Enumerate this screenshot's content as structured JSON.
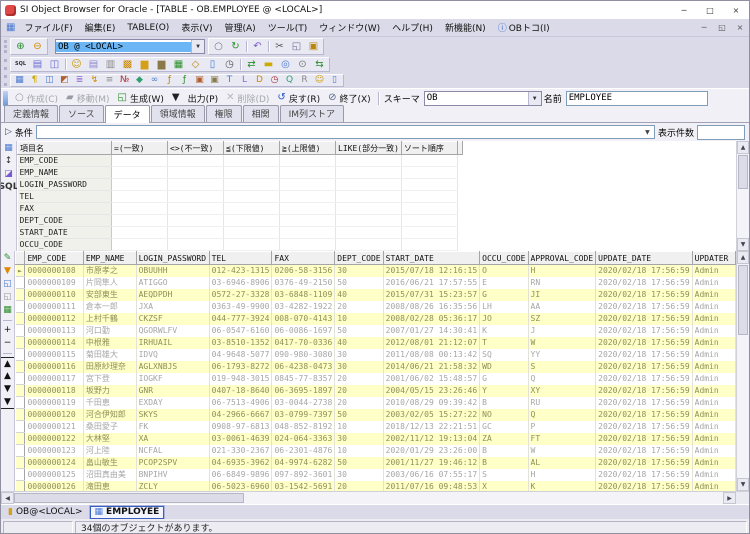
{
  "window": {
    "title": "SI Object Browser for Oracle - [TABLE - OB.EMPLOYEE @ <LOCAL>]",
    "controls": [
      {
        "name": "minimize-button",
        "glyph": "─"
      },
      {
        "name": "maximize-button",
        "glyph": "□"
      },
      {
        "name": "close-button",
        "glyph": "×"
      }
    ]
  },
  "menubar": {
    "items": [
      {
        "label": "ファイル(F)"
      },
      {
        "label": "編集(E)"
      },
      {
        "label": "TABLE(O)"
      },
      {
        "label": "表示(V)"
      },
      {
        "label": "管理(A)"
      },
      {
        "label": "ツール(T)"
      },
      {
        "label": "ウィンドウ(W)"
      },
      {
        "label": "ヘルプ(H)"
      },
      {
        "label": "新機能(N)"
      },
      {
        "label": "OBトコ(I)",
        "icon_name": "info-icon",
        "icon_glyph": "ⓘ",
        "icon_color": "#3366cc"
      }
    ],
    "controls": [
      {
        "name": "mdi-minimize-button",
        "glyph": "─"
      },
      {
        "name": "mdi-restore-button",
        "glyph": "◱"
      },
      {
        "name": "mdi-close-button",
        "glyph": "×"
      }
    ]
  },
  "toolbar1": {
    "icons_left": [
      {
        "name": "connect-icon",
        "glyph": "⊕",
        "color": "#2a8f2a"
      },
      {
        "name": "disconnect-icon",
        "glyph": "⊖",
        "color": "#cc8800"
      }
    ],
    "connection_value": "OB @ <LOCAL>",
    "icons_right": [
      {
        "name": "cancel-query-icon",
        "glyph": "○",
        "color": "#777777"
      },
      {
        "name": "refresh-icon",
        "glyph": "↻",
        "color": "#2a8f2a"
      },
      {
        "sep": true
      },
      {
        "name": "undo-icon",
        "glyph": "↶",
        "color": "#7a5ad0"
      },
      {
        "sep": true
      },
      {
        "name": "cut-icon",
        "glyph": "✂",
        "color": "#555555"
      },
      {
        "name": "copy-icon",
        "glyph": "◱",
        "color": "#777799"
      },
      {
        "name": "paste-icon",
        "glyph": "▣",
        "color": "#b8860b"
      }
    ]
  },
  "toolbar2": {
    "icons": [
      {
        "name": "sql-editor-icon",
        "glyph": "SQL",
        "color": "#333333",
        "small": true
      },
      {
        "name": "script-editor-icon",
        "glyph": "▤",
        "color": "#6a6ad0"
      },
      {
        "name": "session-list-icon",
        "glyph": "◫",
        "color": "#6a6ad0"
      },
      {
        "sep": true
      },
      {
        "name": "user-icon",
        "glyph": "☺",
        "color": "#cc9900"
      },
      {
        "name": "tablespace-icon",
        "glyph": "▤",
        "color": "#8888cc"
      },
      {
        "name": "printer-icon",
        "glyph": "▥",
        "color": "#888888"
      },
      {
        "name": "lock-icon",
        "glyph": "▩",
        "color": "#cc8800"
      },
      {
        "name": "folder-icon",
        "glyph": "▆",
        "color": "#d4a017"
      },
      {
        "name": "folder-dark-icon",
        "glyph": "▆",
        "color": "#8a7a4a"
      },
      {
        "name": "data-grid-icon",
        "glyph": "▦",
        "color": "#2a8f2a"
      },
      {
        "name": "package-icon",
        "glyph": "◇",
        "color": "#b8860b"
      },
      {
        "name": "document-icon",
        "glyph": "▯",
        "color": "#4a7ad0"
      },
      {
        "name": "history-icon",
        "glyph": "◷",
        "color": "#555555"
      },
      {
        "sep": true
      },
      {
        "name": "refresh-objects-icon",
        "glyph": "⇄",
        "color": "#2a8f2a"
      },
      {
        "name": "memo-icon",
        "glyph": "▬",
        "color": "#ccaa00"
      },
      {
        "name": "find-object-icon",
        "glyph": "◎",
        "color": "#4a7ad0"
      },
      {
        "name": "zoom-icon",
        "glyph": "⊙",
        "color": "#777777"
      },
      {
        "name": "sync-table-icon",
        "glyph": "⇆",
        "color": "#2a8f2a"
      }
    ]
  },
  "toolbar3": {
    "icons": [
      {
        "name": "table-object-icon",
        "glyph": "▦",
        "color": "#4a7ad0"
      },
      {
        "name": "key-object-icon",
        "glyph": "¶",
        "color": "#ccaa00"
      },
      {
        "name": "view-object-icon",
        "glyph": "◫",
        "color": "#4a7ad0"
      },
      {
        "name": "mview-object-icon",
        "glyph": "◩",
        "color": "#b06030"
      },
      {
        "name": "index-object-icon",
        "glyph": "≣",
        "color": "#8a6ad0"
      },
      {
        "name": "trigger-object-icon",
        "glyph": "↯",
        "color": "#cc8800"
      },
      {
        "name": "synonym-object-icon",
        "glyph": "≡",
        "color": "#888888"
      },
      {
        "name": "sequence-object-icon",
        "glyph": "№",
        "color": "#b03030"
      },
      {
        "name": "cluster-object-icon",
        "glyph": "◆",
        "color": "#30a070"
      },
      {
        "name": "dblink-object-icon",
        "glyph": "∞",
        "color": "#4a7ad0"
      },
      {
        "name": "procedure-object-icon",
        "glyph": "ƒ",
        "color": "#b8860b"
      },
      {
        "name": "function-object-icon",
        "glyph": "ƒ",
        "color": "#2a8f2a"
      },
      {
        "name": "package-object-icon",
        "glyph": "▣",
        "color": "#b06030"
      },
      {
        "name": "package-body-object-icon",
        "glyph": "▣",
        "color": "#8a7a4a"
      },
      {
        "name": "type-object-icon",
        "glyph": "T",
        "color": "#4a7ad0"
      },
      {
        "name": "library-object-icon",
        "glyph": "L",
        "color": "#8a6ad0"
      },
      {
        "name": "directory-object-icon",
        "glyph": "D",
        "color": "#cc8800"
      },
      {
        "name": "job-object-icon",
        "glyph": "◷",
        "color": "#b03030"
      },
      {
        "name": "queue-object-icon",
        "glyph": "Q",
        "color": "#30a070"
      },
      {
        "name": "role-object-icon",
        "glyph": "R",
        "color": "#888888"
      },
      {
        "name": "user-object-icon",
        "glyph": "☺",
        "color": "#cc9900"
      },
      {
        "name": "recyclebin-object-icon",
        "glyph": "▯",
        "color": "#4a7ad0"
      }
    ]
  },
  "action_bar": {
    "buttons": [
      {
        "name": "create-button",
        "glyph": "○",
        "color": "#9a9aa6",
        "label": "作成(C)",
        "disabled": true
      },
      {
        "name": "move-button",
        "glyph": "▰",
        "color": "#9a9aa6",
        "label": "移動(M)",
        "disabled": true
      },
      {
        "name": "generate-button",
        "glyph": "◱",
        "color": "#2a8f2a",
        "label": "生成(W)",
        "disabled": false
      },
      {
        "name": "generate-dropdown",
        "glyph": "▼",
        "color": "#222222",
        "label": "",
        "disabled": false
      },
      {
        "name": "output-button",
        "glyph": "",
        "color": "",
        "label": "出力(P)",
        "disabled": false
      },
      {
        "name": "delete-button",
        "glyph": "✕",
        "color": "#b6b6be",
        "label": "削除(D)",
        "disabled": true
      },
      {
        "name": "revert-button",
        "glyph": "↺",
        "color": "#2255cc",
        "label": "戻す(R)",
        "disabled": false
      },
      {
        "name": "close-table-button",
        "glyph": "⊘",
        "color": "#556688",
        "label": "終了(X)",
        "disabled": false
      }
    ],
    "schema_label": "スキーマ",
    "schema_value": "OB",
    "name_label": "名前",
    "name_value": "EMPLOYEE"
  },
  "tabs": {
    "items": [
      "定義情報",
      "ソース",
      "データ",
      "領域情報",
      "権限",
      "相関",
      "IM列ストア"
    ],
    "active": "データ"
  },
  "condition": {
    "label": "条件",
    "value": "",
    "count_label": "表示件数",
    "count_value": ""
  },
  "filter_grid": {
    "toolbar": [
      {
        "name": "filter-grid-icon",
        "glyph": "▦",
        "color": "#4a7ad0"
      },
      {
        "name": "toggle-condition-icon",
        "glyph": "↕",
        "color": "#333333"
      },
      {
        "name": "clear-condition-icon",
        "glyph": "◪",
        "color": "#7a5ad0"
      },
      {
        "name": "show-sql-icon",
        "glyph": "SQL",
        "color": "#333333",
        "small": true
      }
    ],
    "headers": [
      "項目名",
      "=(一致)",
      "<>(不一致)",
      "≦(下限値)",
      "≧(上限値)",
      "LIKE(部分一致)",
      "ソート順序"
    ],
    "fields": [
      "EMP_CODE",
      "EMP_NAME",
      "LOGIN_PASSWORD",
      "TEL",
      "FAX",
      "DEPT_CODE",
      "START_DATE",
      "OCCU_CODE"
    ]
  },
  "data_grid": {
    "toolbar": [
      {
        "name": "edit-mode-icon",
        "glyph": "✎",
        "color": "#2a8f2a"
      },
      {
        "name": "filter-rows-icon",
        "glyph": "▼",
        "color": "#e08800"
      },
      {
        "name": "copy-rows-icon",
        "glyph": "◱",
        "color": "#4a7ad0"
      },
      {
        "name": "paste-rows-icon",
        "glyph": "◱",
        "color": "#999999"
      },
      {
        "name": "export-grid-icon",
        "glyph": "▦",
        "color": "#2a8f2a"
      },
      {
        "sep": true
      },
      {
        "name": "insert-row-icon",
        "glyph": "+",
        "color": "#111111"
      },
      {
        "name": "delete-row-icon",
        "glyph": "−",
        "color": "#111111"
      },
      {
        "sep": true
      },
      {
        "name": "first-row-icon",
        "glyph": "▲",
        "color": "#111111",
        "cls": "bar-top"
      },
      {
        "name": "prev-row-icon",
        "glyph": "▲",
        "color": "#111111"
      },
      {
        "name": "next-row-icon",
        "glyph": "▼",
        "color": "#111111"
      },
      {
        "name": "last-row-icon",
        "glyph": "▼",
        "color": "#111111",
        "cls": "bar-bottom"
      }
    ],
    "columns": [
      "EMP_CODE",
      "EMP_NAME",
      "LOGIN_PASSWORD",
      "TEL",
      "FAX",
      "DEPT_CODE",
      "START_DATE",
      "OCCU_CODE",
      "APPROVAL_CODE",
      "UPDATE_DATE",
      "UPDATER"
    ],
    "rows": [
      [
        "0000000108",
        "市原孝之",
        "OBUUHH",
        "012-423-1315",
        "0206-58-3156",
        "30",
        "2015/07/18 12:16:15",
        "O",
        "H",
        "2020/02/18 17:56:59",
        "Admin"
      ],
      [
        "0000000109",
        "片岡隼人",
        "ATIGGO",
        "03-6946-8906",
        "0376-49-2150",
        "50",
        "2016/06/21 17:57:55",
        "E",
        "RN",
        "2020/02/18 17:56:59",
        "Admin"
      ],
      [
        "0000000110",
        "安部東生",
        "AEQDPDH",
        "0572-27-3328",
        "03-6848-1109",
        "40",
        "2015/07/31 15:23:57",
        "G",
        "JI",
        "2020/02/18 17:56:59",
        "Admin"
      ],
      [
        "0000000111",
        "倉本一郎",
        "JXA",
        "0363-49-9900",
        "03-4282-1922",
        "20",
        "2008/08/26 16:35:56",
        "LH",
        "AA",
        "2020/02/18 17:56:59",
        "Admin"
      ],
      [
        "0000000112",
        "上村千鶴",
        "CKZSF",
        "044-777-3924",
        "008-070-4143",
        "10",
        "2008/02/28 05:36:17",
        "JO",
        "SZ",
        "2020/02/18 17:56:59",
        "Admin"
      ],
      [
        "0000000113",
        "河口勤",
        "QGORWLFV",
        "06-0547-6160",
        "06-0086-1697",
        "50",
        "2007/01/27 14:30:41",
        "K",
        "J",
        "2020/02/18 17:56:59",
        "Admin"
      ],
      [
        "0000000114",
        "中根雅",
        "IRHUAIL",
        "03-8510-1352",
        "0417-70-0336",
        "40",
        "2012/08/01 21:12:07",
        "T",
        "W",
        "2020/02/18 17:56:59",
        "Admin"
      ],
      [
        "0000000115",
        "菊田雄大",
        "IDVQ",
        "04-9648-5077",
        "090-980-3080",
        "30",
        "2011/08/08 00:13:42",
        "SQ",
        "YY",
        "2020/02/18 17:56:59",
        "Admin"
      ],
      [
        "0000000116",
        "田原紗理奈",
        "AGLXNBJS",
        "06-1793-8272",
        "06-4238-0473",
        "30",
        "2014/06/21 21:58:32",
        "WD",
        "S",
        "2020/02/18 17:56:59",
        "Admin"
      ],
      [
        "0000000117",
        "宮下登",
        "IOGKF",
        "019-948-3015",
        "0845-77-8357",
        "20",
        "2001/06/02 15:48:57",
        "G",
        "Q",
        "2020/02/18 17:56:59",
        "Admin"
      ],
      [
        "0000000118",
        "坂野力",
        "GNR",
        "0407-18-8640",
        "06-3695-1897",
        "20",
        "2004/05/15 23:26:46",
        "Y",
        "XY",
        "2020/02/18 17:56:59",
        "Admin"
      ],
      [
        "0000000119",
        "千田恵",
        "EXDAY",
        "06-7513-4906",
        "03-0044-2738",
        "20",
        "2010/08/29 09:39:42",
        "B",
        "RU",
        "2020/02/18 17:56:59",
        "Admin"
      ],
      [
        "0000000120",
        "河合伊知郎",
        "SKYS",
        "04-2966-6667",
        "03-0799-7397",
        "50",
        "2003/02/05 15:27:22",
        "NO",
        "Q",
        "2020/02/18 17:56:59",
        "Admin"
      ],
      [
        "0000000121",
        "桑田愛子",
        "FK",
        "0908-97-6813",
        "048-852-8192",
        "10",
        "2018/12/13 22:21:51",
        "GC",
        "P",
        "2020/02/18 17:56:59",
        "Admin"
      ],
      [
        "0000000122",
        "大林堅",
        "XA",
        "03-0061-4639",
        "024-064-3363",
        "30",
        "2002/11/12 19:13:04",
        "ZA",
        "FT",
        "2020/02/18 17:56:59",
        "Admin"
      ],
      [
        "0000000123",
        "河上陸",
        "NCFAL",
        "021-330-2367",
        "06-2301-4876",
        "10",
        "2020/01/29 23:26:00",
        "B",
        "W",
        "2020/02/18 17:56:59",
        "Admin"
      ],
      [
        "0000000124",
        "畠山敏生",
        "PCOP2SPV",
        "04-6935-3962",
        "04-9974-6282",
        "50",
        "2001/11/27 19:46:12",
        "B",
        "AL",
        "2020/02/18 17:56:59",
        "Admin"
      ],
      [
        "0000000125",
        "沼田真由美",
        "BNPIHV",
        "06-6849-9896",
        "097-892-3601",
        "30",
        "2003/06/16 07:55:17",
        "S",
        "H",
        "2020/02/18 17:56:59",
        "Admin"
      ],
      [
        "0000000126",
        "滝田恵",
        "ZCLY",
        "06-5023-6960",
        "03-1542-5691",
        "20",
        "2011/07/16 09:48:53",
        "X",
        "K",
        "2020/02/18 17:56:59",
        "Admin"
      ]
    ]
  },
  "taskbar": {
    "buttons": [
      {
        "name": "connection-window-button",
        "label": "OB@<LOCAL>",
        "glyph": "▮",
        "color": "#d4a017",
        "active": false
      },
      {
        "name": "employee-window-button",
        "label": "EMPLOYEE",
        "glyph": "▦",
        "color": "#4a7ad0",
        "active": true
      }
    ]
  },
  "status_bar": {
    "message": "34個のオブジェクトがあります。"
  },
  "colors": {
    "row_alt": "#ffffc8",
    "chrome": "#dadae8",
    "accent": "#3a5fc0"
  }
}
